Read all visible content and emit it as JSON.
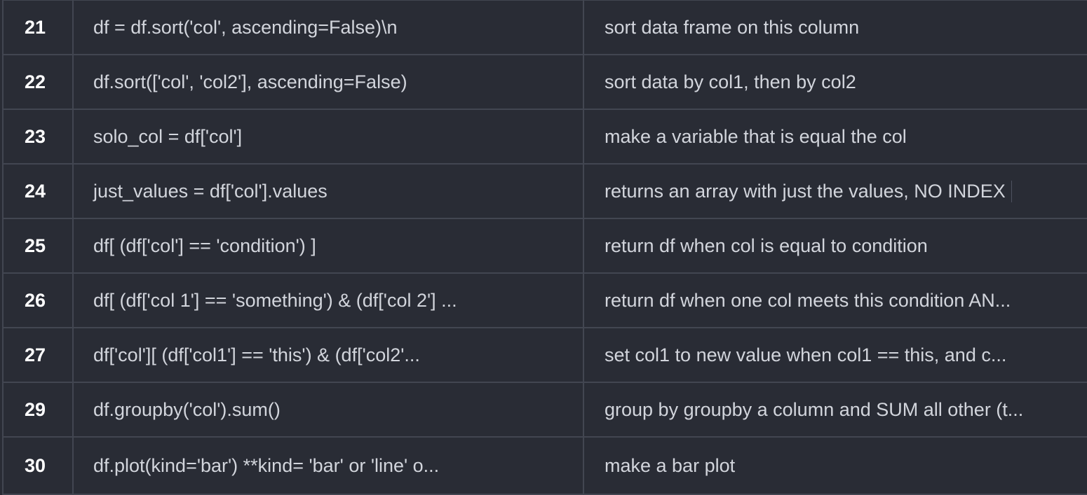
{
  "table": {
    "rows": [
      {
        "num": "21",
        "code": "df = df.sort('col', ascending=False)\\n",
        "desc": "sort data frame on this column"
      },
      {
        "num": "22",
        "code": "df.sort(['col', 'col2'], ascending=False)",
        "desc": "sort data by col1, then by col2"
      },
      {
        "num": "23",
        "code": "solo_col = df['col']",
        "desc": "make a variable that is equal the col"
      },
      {
        "num": "24",
        "code": "just_values = df['col'].values",
        "desc": "returns an array with just the values, NO INDEX"
      },
      {
        "num": "25",
        "code": "df[ (df['col'] == 'condition') ]",
        "desc": "return df when col is equal to condition"
      },
      {
        "num": "26",
        "code": "df[ (df['col 1'] == 'something') & (df['col 2'] ...",
        "desc": "return df when one col meets this condition AN..."
      },
      {
        "num": "27",
        "code": "df['col'][ (df['col1'] == 'this') & (df['col2'...",
        "desc": "set col1 to new value when col1 == this, and c..."
      },
      {
        "num": "29",
        "code": "df.groupby('col').sum()",
        "desc": "group by groupby a column and SUM all other (t..."
      },
      {
        "num": "30",
        "code": "df.plot(kind='bar') **kind= 'bar' or 'line' o...",
        "desc": "make a bar plot"
      }
    ]
  }
}
